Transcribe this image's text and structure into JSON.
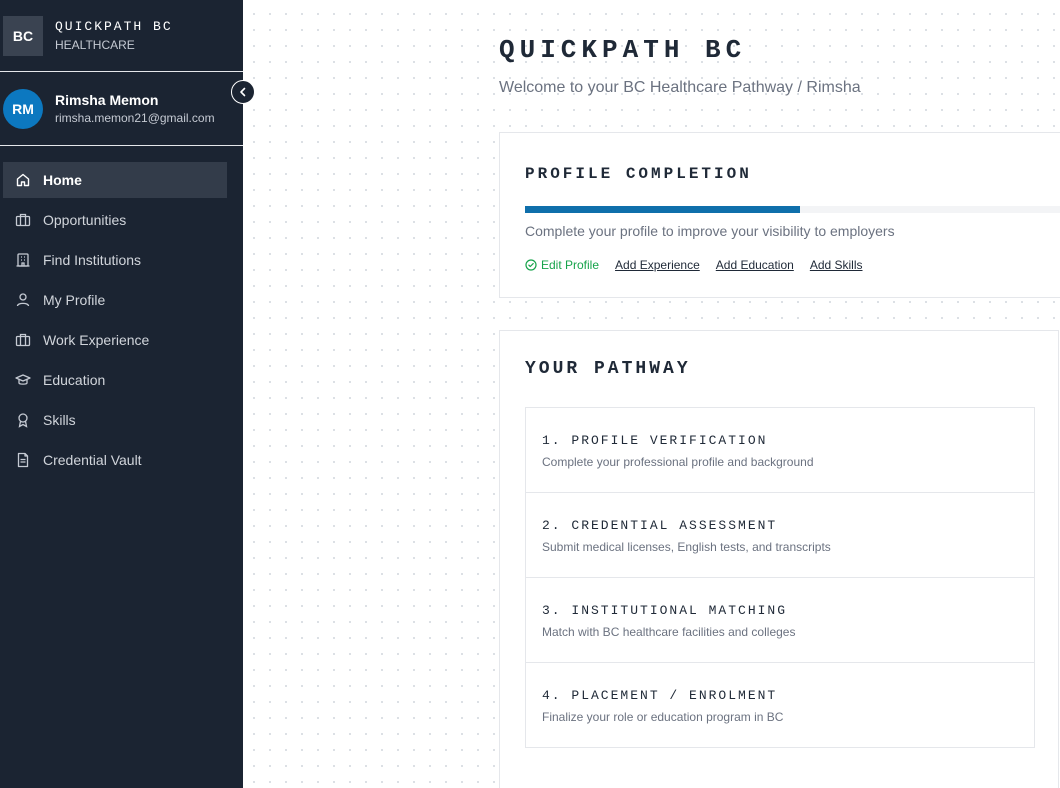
{
  "brand": {
    "logo": "BC",
    "name": "QUICKPATH BC",
    "subtitle": "HEALTHCARE"
  },
  "user": {
    "initials": "RM",
    "name": "Rimsha Memon",
    "email": "rimsha.memon21@gmail.com"
  },
  "sidebar": {
    "collapse_icon": "chevron-left-icon",
    "items": [
      {
        "label": "Home",
        "icon": "home-icon",
        "active": true
      },
      {
        "label": "Opportunities",
        "icon": "briefcase-icon",
        "active": false
      },
      {
        "label": "Find Institutions",
        "icon": "building-icon",
        "active": false
      },
      {
        "label": "My Profile",
        "icon": "user-icon",
        "active": false
      },
      {
        "label": "Work Experience",
        "icon": "briefcase-icon",
        "active": false
      },
      {
        "label": "Education",
        "icon": "graduation-cap-icon",
        "active": false
      },
      {
        "label": "Skills",
        "icon": "award-icon",
        "active": false
      },
      {
        "label": "Credential Vault",
        "icon": "document-icon",
        "active": false
      }
    ]
  },
  "header": {
    "title": "QUICKPATH BC",
    "welcome": "Welcome to your BC Healthcare Pathway / Rimsha"
  },
  "profile_completion": {
    "title": "PROFILE COMPLETION",
    "progress_fraction": 0.51,
    "description": "Complete your profile to improve your visibility to employers",
    "edit_label": "Edit Profile",
    "links": [
      "Add Experience",
      "Add Education",
      "Add Skills"
    ]
  },
  "pathway": {
    "title": "YOUR PATHWAY",
    "steps": [
      {
        "title": "1. PROFILE VERIFICATION",
        "description": "Complete your professional profile and background"
      },
      {
        "title": "2. CREDENTIAL ASSESSMENT",
        "description": "Submit medical licenses, English tests, and transcripts"
      },
      {
        "title": "3. INSTITUTIONAL MATCHING",
        "description": "Match with BC healthcare facilities and colleges"
      },
      {
        "title": "4. PLACEMENT / ENROLMENT",
        "description": "Finalize your role or education program in BC"
      }
    ]
  },
  "colors": {
    "sidebar_bg": "#1b2432",
    "accent": "#0f6fab",
    "avatar": "#0c78c0",
    "success": "#16a34a"
  }
}
